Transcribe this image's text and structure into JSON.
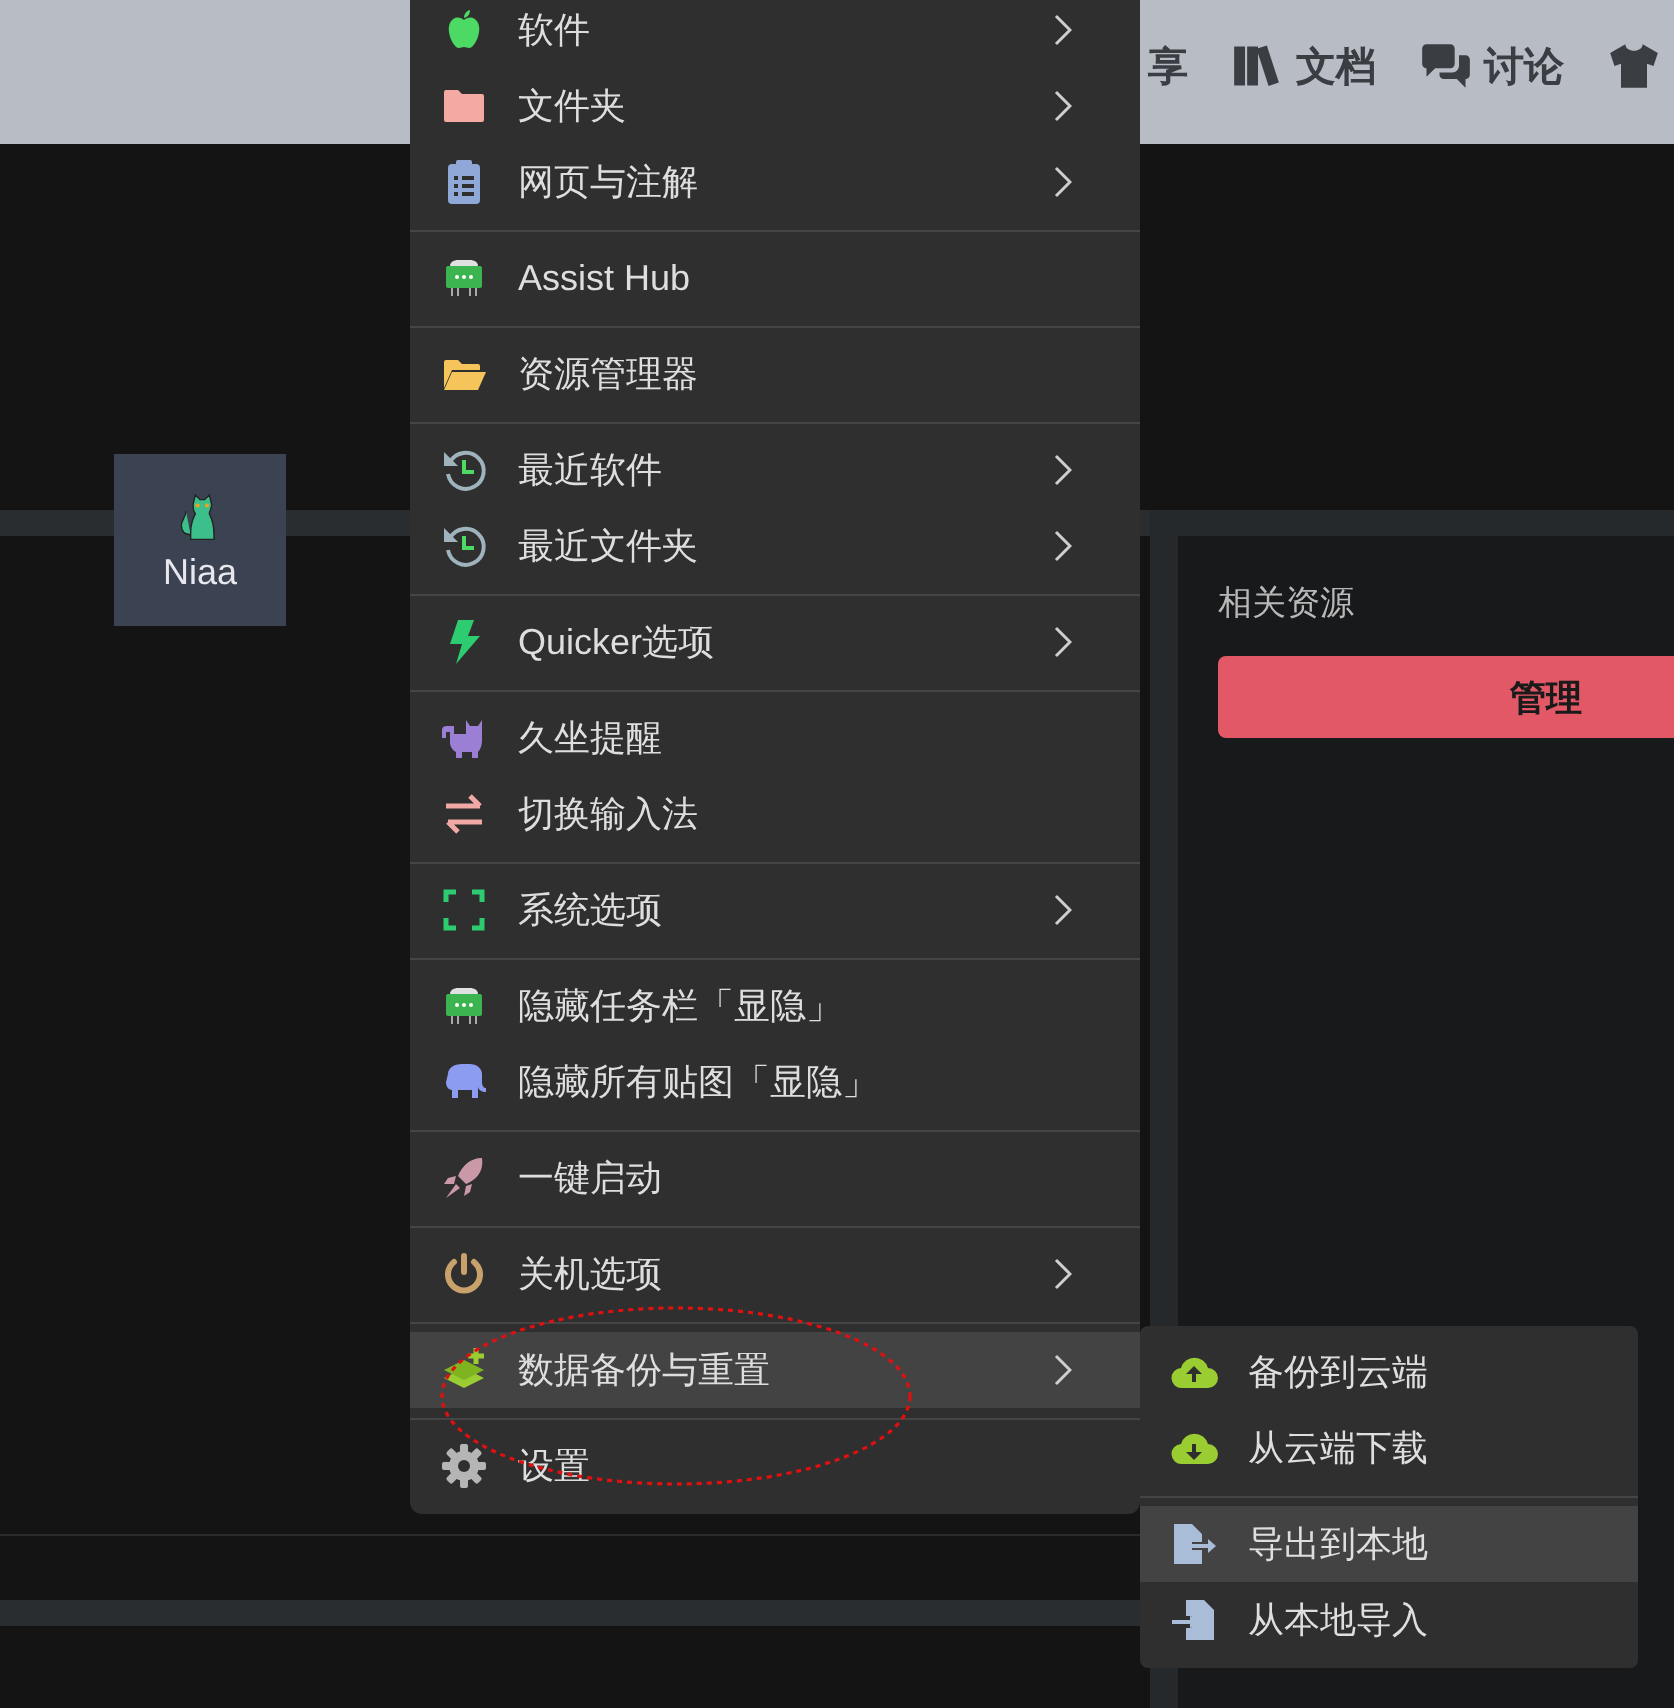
{
  "header": {
    "nav": [
      {
        "kind": "text",
        "label": "享"
      },
      {
        "kind": "books",
        "label": "文档"
      },
      {
        "kind": "chat",
        "label": "讨论"
      },
      {
        "kind": "shirt"
      }
    ]
  },
  "card": {
    "label": "Niaa"
  },
  "panel": {
    "title": "相关资源",
    "button": "管理"
  },
  "menu": {
    "groups": [
      {
        "items": [
          {
            "kind": "apple",
            "label": "软件",
            "submenu": true,
            "selected": false
          },
          {
            "kind": "folder",
            "label": "文件夹",
            "submenu": true,
            "selected": false
          },
          {
            "kind": "clipboard",
            "label": "网页与注解",
            "submenu": true,
            "selected": false
          }
        ]
      },
      {
        "items": [
          {
            "kind": "robot",
            "label": "Assist Hub",
            "submenu": false,
            "selected": false
          }
        ]
      },
      {
        "items": [
          {
            "kind": "open-folder",
            "label": "资源管理器",
            "submenu": false,
            "selected": false
          }
        ]
      },
      {
        "items": [
          {
            "kind": "history",
            "label": "最近软件",
            "submenu": true,
            "selected": false
          },
          {
            "kind": "history",
            "label": "最近文件夹",
            "submenu": true,
            "selected": false
          }
        ]
      },
      {
        "items": [
          {
            "kind": "bolt",
            "label": "Quicker选项",
            "submenu": true,
            "selected": false
          }
        ]
      },
      {
        "items": [
          {
            "kind": "cat",
            "label": "久坐提醒",
            "submenu": false,
            "selected": false
          },
          {
            "kind": "swap",
            "label": "切换输入法",
            "submenu": false,
            "selected": false
          }
        ]
      },
      {
        "items": [
          {
            "kind": "corners",
            "label": "系统选项",
            "submenu": true,
            "selected": false
          }
        ]
      },
      {
        "items": [
          {
            "kind": "robot",
            "label": "隐藏任务栏「显隐」",
            "submenu": false,
            "selected": false
          },
          {
            "kind": "elephant",
            "label": "隐藏所有贴图「显隐」",
            "submenu": false,
            "selected": false
          }
        ]
      },
      {
        "items": [
          {
            "kind": "rocket",
            "label": "一键启动",
            "submenu": false,
            "selected": false
          }
        ]
      },
      {
        "items": [
          {
            "kind": "power",
            "label": "关机选项",
            "submenu": true,
            "selected": false
          }
        ]
      },
      {
        "items": [
          {
            "kind": "layers",
            "label": "数据备份与重置",
            "submenu": true,
            "selected": true
          }
        ]
      },
      {
        "items": [
          {
            "kind": "gear",
            "label": "设置",
            "submenu": false,
            "selected": false
          }
        ]
      }
    ]
  },
  "submenu": {
    "groups": [
      {
        "items": [
          {
            "kind": "cloud-up",
            "label": "备份到云端",
            "selected": false
          },
          {
            "kind": "cloud-down",
            "label": "从云端下载",
            "selected": false
          }
        ]
      },
      {
        "items": [
          {
            "kind": "file-export",
            "label": "导出到本地",
            "selected": true
          },
          {
            "kind": "file-import",
            "label": "从本地导入",
            "selected": false
          }
        ]
      }
    ]
  }
}
